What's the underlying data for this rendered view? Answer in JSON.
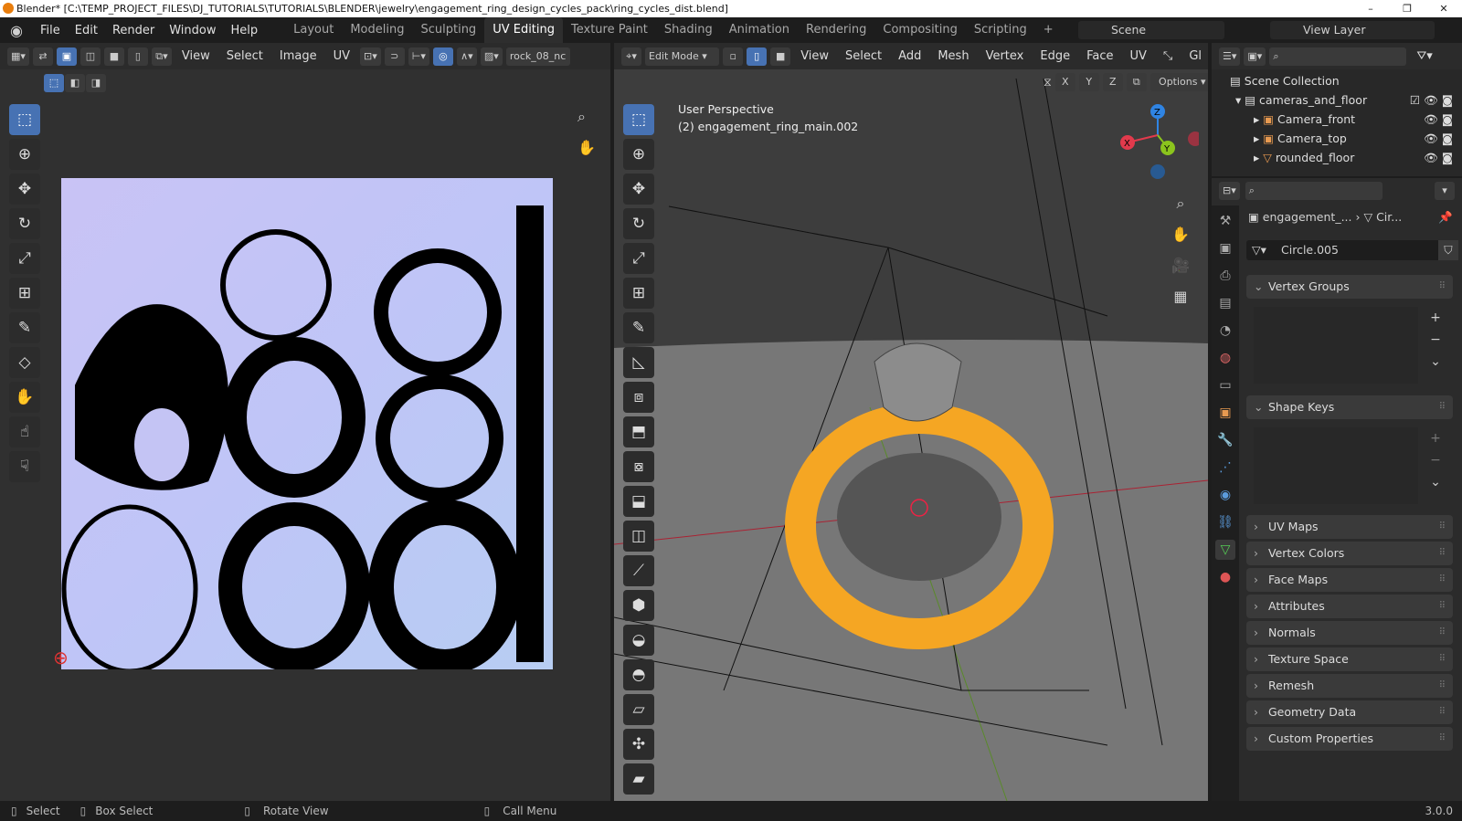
{
  "title": "Blender* [C:\\TEMP_PROJECT_FILES\\DJ_TUTORIALS\\TUTORIALS\\BLENDER\\jewelry\\engagement_ring_design_cycles_pack\\ring_cycles_dist.blend]",
  "menus": [
    "File",
    "Edit",
    "Render",
    "Window",
    "Help"
  ],
  "workspaces": [
    "Layout",
    "Modeling",
    "Sculpting",
    "UV Editing",
    "Texture Paint",
    "Shading",
    "Animation",
    "Rendering",
    "Compositing",
    "Scripting"
  ],
  "active_workspace": "UV Editing",
  "scene": "Scene",
  "view_layer": "View Layer",
  "uv_header": {
    "menus": [
      "View",
      "Select",
      "Image",
      "UV"
    ],
    "image_name": "rock_08_nc"
  },
  "viewport_header": {
    "mode": "Edit Mode",
    "menus": [
      "View",
      "Select",
      "Add",
      "Mesh",
      "Vertex",
      "Edge",
      "Face",
      "UV"
    ],
    "gl": "Gl",
    "axes": [
      "X",
      "Y",
      "Z"
    ],
    "options": "Options"
  },
  "viewport_overlay": {
    "perspective": "User Perspective",
    "object": "(2) engagement_ring_main.002"
  },
  "gizmo": {
    "x": "X",
    "y": "Y",
    "z": "Z",
    "colors": {
      "x": "#e23a4c",
      "y": "#8bc41d",
      "z": "#2f84e3"
    }
  },
  "outliner": {
    "root": "Scene Collection",
    "items": [
      {
        "name": "cameras_and_floor",
        "level": 1
      },
      {
        "name": "Camera_front",
        "level": 2
      },
      {
        "name": "Camera_top",
        "level": 2
      },
      {
        "name": "rounded_floor",
        "level": 2
      }
    ]
  },
  "properties": {
    "breadcrumb_object": "engagement_...",
    "breadcrumb_data": "Cir...",
    "mesh_name": "Circle.005",
    "sections_open": [
      "Vertex Groups",
      "Shape Keys"
    ],
    "sections_closed": [
      "UV Maps",
      "Vertex Colors",
      "Face Maps",
      "Attributes",
      "Normals",
      "Texture Space",
      "Remesh",
      "Geometry Data",
      "Custom Properties"
    ]
  },
  "statusbar": {
    "select": "Select",
    "box_select": "Box Select",
    "rotate": "Rotate View",
    "menu": "Call Menu",
    "version": "3.0.0"
  },
  "colors": {
    "accent": "#4772b3",
    "selection": "#f5a623"
  }
}
